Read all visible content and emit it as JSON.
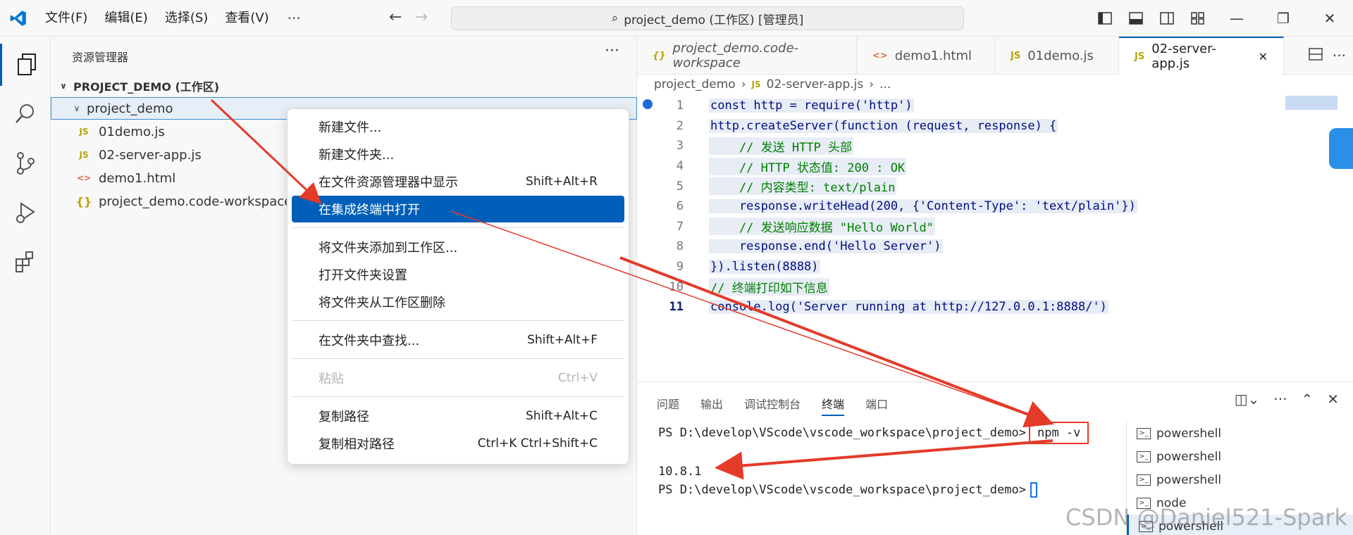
{
  "menubar": {
    "items": [
      "文件(F)",
      "编辑(E)",
      "选择(S)",
      "查看(V)"
    ],
    "more": "···"
  },
  "command_center": {
    "text": "project_demo (工作区) [管理员]"
  },
  "sidebar": {
    "title": "资源管理器",
    "more": "···",
    "workspace": "PROJECT_DEMO (工作区)",
    "folder": "project_demo",
    "files": [
      {
        "icon": "JS",
        "name": "01demo.js"
      },
      {
        "icon": "JS",
        "name": "02-server-app.js"
      },
      {
        "icon": "<>",
        "name": "demo1.html"
      },
      {
        "icon": "{}",
        "name": "project_demo.code-workspace"
      }
    ]
  },
  "tabs": [
    {
      "icon": "{}",
      "label": "project_demo.code-workspace"
    },
    {
      "icon": "<>",
      "label": "demo1.html"
    },
    {
      "icon": "JS",
      "label": "01demo.js"
    },
    {
      "icon": "JS",
      "label": "02-server-app.js",
      "close": "✕"
    }
  ],
  "breadcrumb": {
    "folder": "project_demo",
    "file": "02-server-app.js",
    "more": "..."
  },
  "code": {
    "line_numbers": [
      "1",
      "2",
      "3",
      "4",
      "5",
      "6",
      "7",
      "8",
      "9",
      "10",
      "11"
    ],
    "current_line": "11",
    "lines": [
      "const http = require('http')",
      "http.createServer(function (request, response) {",
      "    // 发送 HTTP 头部",
      "    // HTTP 状态值: 200 : OK",
      "    // 内容类型: text/plain",
      "    response.writeHead(200, {'Content-Type': 'text/plain'})",
      "    // 发送响应数据 \"Hello World\"",
      "    response.end('Hello Server')",
      "}).listen(8888)",
      "// 终端打印如下信息",
      "console.log('Server running at http://127.0.0.1:8888/')"
    ]
  },
  "context_menu": {
    "groups": [
      [
        {
          "label": "新建文件...",
          "shortcut": ""
        },
        {
          "label": "新建文件夹...",
          "shortcut": ""
        },
        {
          "label": "在文件资源管理器中显示",
          "shortcut": "Shift+Alt+R"
        },
        {
          "label": "在集成终端中打开",
          "shortcut": "",
          "highlighted": true
        }
      ],
      [
        {
          "label": "将文件夹添加到工作区...",
          "shortcut": ""
        },
        {
          "label": "打开文件夹设置",
          "shortcut": ""
        },
        {
          "label": "将文件夹从工作区删除",
          "shortcut": ""
        }
      ],
      [
        {
          "label": "在文件夹中查找...",
          "shortcut": "Shift+Alt+F"
        }
      ],
      [
        {
          "label": "粘贴",
          "shortcut": "Ctrl+V",
          "disabled": true
        }
      ],
      [
        {
          "label": "复制路径",
          "shortcut": "Shift+Alt+C"
        },
        {
          "label": "复制相对路径",
          "shortcut": "Ctrl+K Ctrl+Shift+C"
        }
      ]
    ]
  },
  "panel": {
    "tabs": [
      "问题",
      "输出",
      "调试控制台",
      "终端",
      "端口"
    ],
    "active_tab": "终端",
    "terminal": {
      "prompt1": "PS D:\\develop\\VScode\\vscode_workspace\\project_demo>",
      "command": "npm -v",
      "output": "10.8.1",
      "prompt2": "PS D:\\develop\\VScode\\vscode_workspace\\project_demo>"
    },
    "terminal_list": [
      "powershell",
      "powershell",
      "powershell",
      "node",
      "powershell"
    ]
  },
  "watermark": "CSDN @Daniel521-Spark",
  "colors": {
    "accent": "#005fb8",
    "annotation_red": "#e43a2a"
  }
}
